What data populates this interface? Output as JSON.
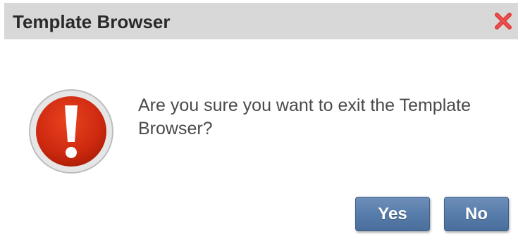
{
  "dialog": {
    "title": "Template Browser",
    "message": "Are you sure you want to exit the Template Browser?",
    "icon": "exclamation-alert-icon",
    "close_icon": "close-icon"
  },
  "buttons": {
    "yes_label": "Yes",
    "no_label": "No"
  },
  "colors": {
    "titlebar_bg": "#d8d8d8",
    "close_red": "#e23a3a",
    "alert_red": "#d72b12",
    "button_blue": "#557ba9"
  }
}
